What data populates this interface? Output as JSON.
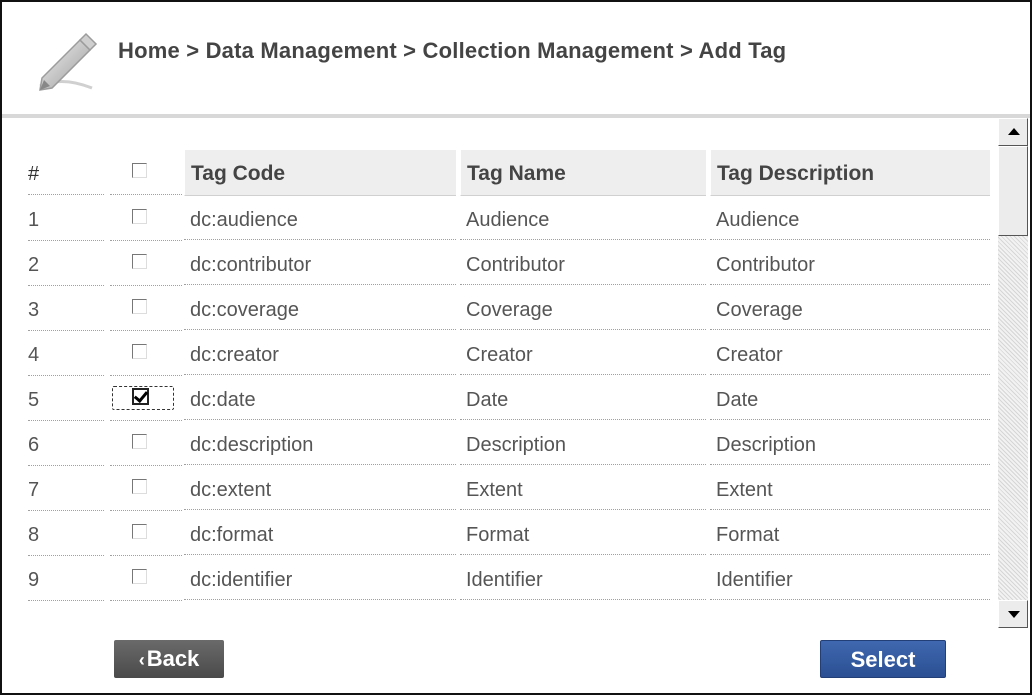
{
  "header": {
    "breadcrumb": "Home > Data Management > Collection Management > Add Tag",
    "icon": "pencil-icon"
  },
  "table": {
    "columns": {
      "num": "#",
      "code": "Tag Code",
      "name": "Tag Name",
      "desc": "Tag Description"
    },
    "select_all_checked": false,
    "rows": [
      {
        "num": "1",
        "code": "dc:audience",
        "name": "Audience",
        "desc": "Audience",
        "checked": false
      },
      {
        "num": "2",
        "code": "dc:contributor",
        "name": "Contributor",
        "desc": "Contributor",
        "checked": false
      },
      {
        "num": "3",
        "code": "dc:coverage",
        "name": "Coverage",
        "desc": "Coverage",
        "checked": false
      },
      {
        "num": "4",
        "code": "dc:creator",
        "name": "Creator",
        "desc": "Creator",
        "checked": false
      },
      {
        "num": "5",
        "code": "dc:date",
        "name": "Date",
        "desc": "Date",
        "checked": true,
        "focused": true
      },
      {
        "num": "6",
        "code": "dc:description",
        "name": "Description",
        "desc": "Description",
        "checked": false
      },
      {
        "num": "7",
        "code": "dc:extent",
        "name": "Extent",
        "desc": "Extent",
        "checked": false
      },
      {
        "num": "8",
        "code": "dc:format",
        "name": "Format",
        "desc": "Format",
        "checked": false
      },
      {
        "num": "9",
        "code": "dc:identifier",
        "name": "Identifier",
        "desc": "Identifier",
        "checked": false
      }
    ]
  },
  "buttons": {
    "back": "Back",
    "select": "Select"
  },
  "colors": {
    "select_button": "#2f5599",
    "back_button": "#555555"
  }
}
